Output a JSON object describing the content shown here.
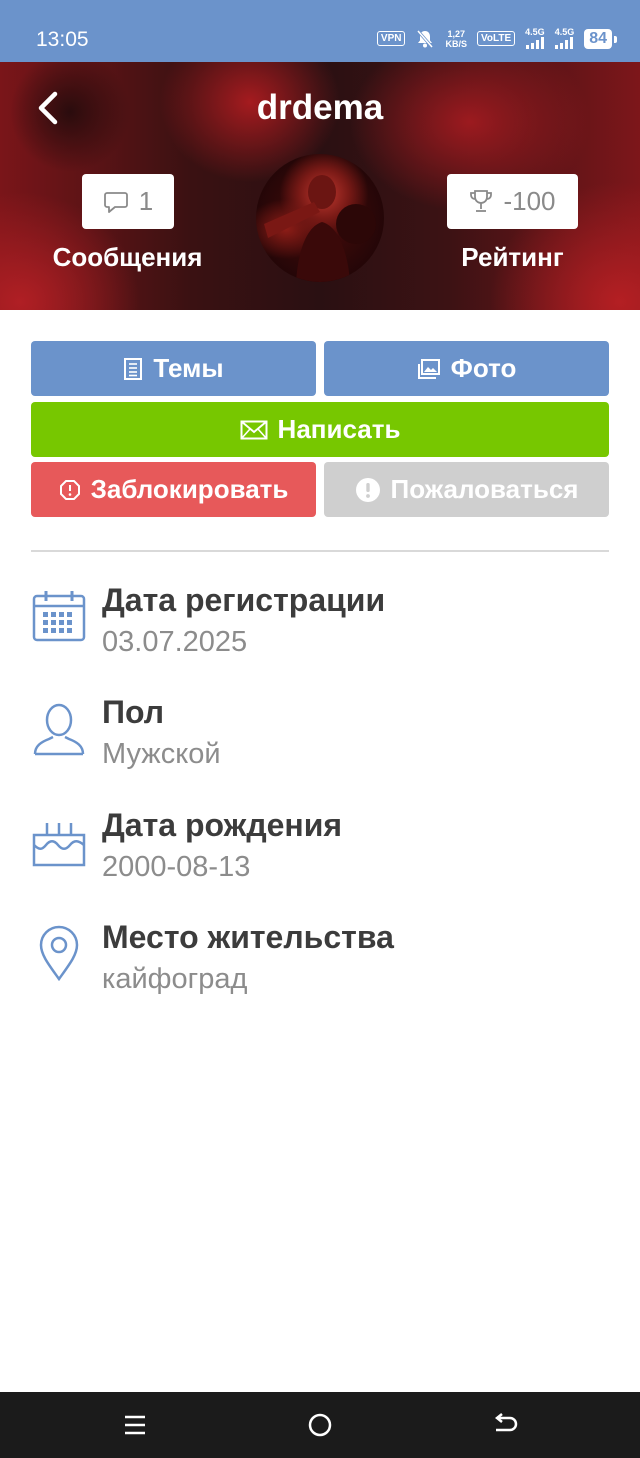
{
  "status_bar": {
    "time": "13:05",
    "vpn": "VPN",
    "speed_top": "1,27",
    "speed_bottom": "KB/S",
    "volte": "VoLTE",
    "net1": "4.5G",
    "net2": "4.5G",
    "battery": "84"
  },
  "profile": {
    "username": "drdema",
    "messages_count": "1",
    "messages_label": "Сообщения",
    "rating_value": "-100",
    "rating_label": "Рейтинг"
  },
  "actions": {
    "topics": "Темы",
    "photo": "Фото",
    "write": "Написать",
    "block": "Заблокировать",
    "report": "Пожаловаться"
  },
  "info": [
    {
      "title": "Дата регистрации",
      "value": "03.07.2025",
      "icon": "calendar-icon"
    },
    {
      "title": "Пол",
      "value": "Мужской",
      "icon": "person-icon"
    },
    {
      "title": "Дата рождения",
      "value": "2000-08-13",
      "icon": "cake-icon"
    },
    {
      "title": "Место жительства",
      "value": "кайфоград",
      "icon": "location-pin-icon"
    }
  ],
  "colors": {
    "primary": "#6b93cb",
    "write": "#77c700",
    "block": "#e7595a",
    "report": "#cfcfcf",
    "icon": "#6b93cb"
  }
}
